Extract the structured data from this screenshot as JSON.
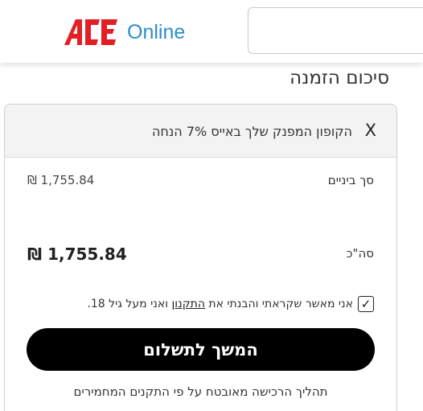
{
  "header": {
    "logo_text_ace": "ACE",
    "logo_text_online": "Online",
    "brand_red": "#e31e24",
    "brand_blue": "#2a8ec9"
  },
  "page": {
    "title": "סיכום הזמנה"
  },
  "coupon": {
    "close_label": "X",
    "text": "הקופון המפנק שלך באייס 7% הנחה"
  },
  "summary": {
    "subtotal_label": "סך ביניים",
    "subtotal_value": "1,755.84 ₪",
    "total_label": "סה\"כ",
    "total_value": "1,755.84 ₪"
  },
  "terms": {
    "checked": true,
    "checkmark": "✓",
    "text_before": "אני מאשר שקראתי והבנתי את ",
    "link_text": "התקנון",
    "text_after": " ואני מעל גיל 18."
  },
  "actions": {
    "pay_button_label": "המשך לתשלום"
  },
  "footer": {
    "secure_text": "תהליך הרכישה מאובטח על פי התקנים המחמירים"
  }
}
